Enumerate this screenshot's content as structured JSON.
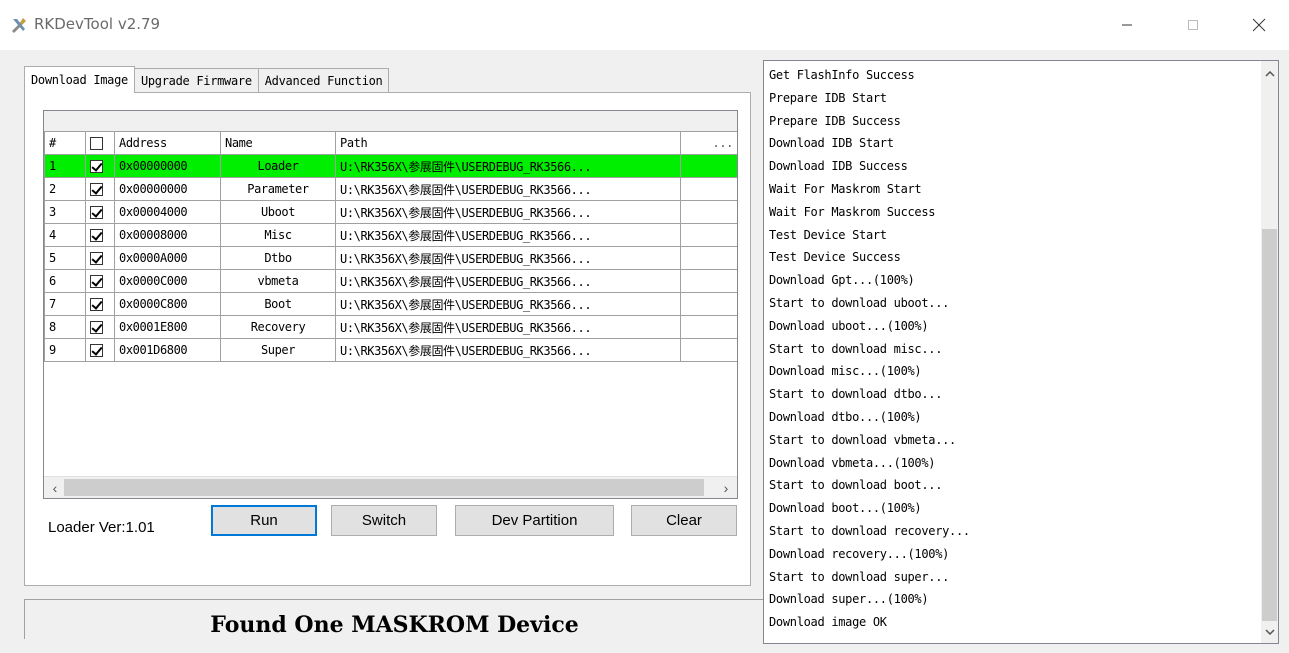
{
  "window": {
    "title": "RKDevTool v2.79",
    "app_icon": "rk-devtool-icon"
  },
  "tabs": [
    {
      "label": "Download Image",
      "active": true
    },
    {
      "label": "Upgrade Firmware",
      "active": false
    },
    {
      "label": "Advanced Function",
      "active": false
    }
  ],
  "grid": {
    "columns": [
      "#",
      "",
      "Address",
      "Name",
      "Path",
      "..."
    ],
    "rows": [
      {
        "index": "1",
        "checked": true,
        "address": "0x00000000",
        "name": "Loader",
        "path": "U:\\RK356X\\参展固件\\USERDEBUG_RK3566...",
        "selected": true
      },
      {
        "index": "2",
        "checked": true,
        "address": "0x00000000",
        "name": "Parameter",
        "path": "U:\\RK356X\\参展固件\\USERDEBUG_RK3566...",
        "selected": false
      },
      {
        "index": "3",
        "checked": true,
        "address": "0x00004000",
        "name": "Uboot",
        "path": "U:\\RK356X\\参展固件\\USERDEBUG_RK3566...",
        "selected": false
      },
      {
        "index": "4",
        "checked": true,
        "address": "0x00008000",
        "name": "Misc",
        "path": "U:\\RK356X\\参展固件\\USERDEBUG_RK3566...",
        "selected": false
      },
      {
        "index": "5",
        "checked": true,
        "address": "0x0000A000",
        "name": "Dtbo",
        "path": "U:\\RK356X\\参展固件\\USERDEBUG_RK3566...",
        "selected": false
      },
      {
        "index": "6",
        "checked": true,
        "address": "0x0000C000",
        "name": "vbmeta",
        "path": "U:\\RK356X\\参展固件\\USERDEBUG_RK3566...",
        "selected": false
      },
      {
        "index": "7",
        "checked": true,
        "address": "0x0000C800",
        "name": "Boot",
        "path": "U:\\RK356X\\参展固件\\USERDEBUG_RK3566...",
        "selected": false
      },
      {
        "index": "8",
        "checked": true,
        "address": "0x0001E800",
        "name": "Recovery",
        "path": "U:\\RK356X\\参展固件\\USERDEBUG_RK3566...",
        "selected": false
      },
      {
        "index": "9",
        "checked": true,
        "address": "0x001D6800",
        "name": "Super",
        "path": "U:\\RK356X\\参展固件\\USERDEBUG_RK3566...",
        "selected": false
      }
    ]
  },
  "loader_ver": "Loader Ver:1.01",
  "buttons": {
    "run": "Run",
    "switch": "Switch",
    "dev_partition": "Dev Partition",
    "clear": "Clear"
  },
  "status": "Found One MASKROM Device",
  "log_lines": [
    "Get FlashInfo Success",
    "Prepare IDB Start",
    "Prepare IDB Success",
    "Download IDB Start",
    "Download IDB Success",
    "Wait For Maskrom Start",
    "Wait For Maskrom Success",
    "Test Device Start",
    "Test Device Success",
    "Download Gpt...(100%)",
    "Start to download uboot...",
    "Download uboot...(100%)",
    "Start to download misc...",
    "Download misc...(100%)",
    "Start to download dtbo...",
    "Download dtbo...(100%)",
    "Start to download vbmeta...",
    "Download vbmeta...(100%)",
    "Start to download boot...",
    "Download boot...(100%)",
    "Start to download recovery...",
    "Download recovery...(100%)",
    "Start to download super...",
    "Download super...(100%)",
    "Download image OK"
  ],
  "colors": {
    "selected_row": "#00ee00",
    "default_button_border": "#0078d7"
  }
}
